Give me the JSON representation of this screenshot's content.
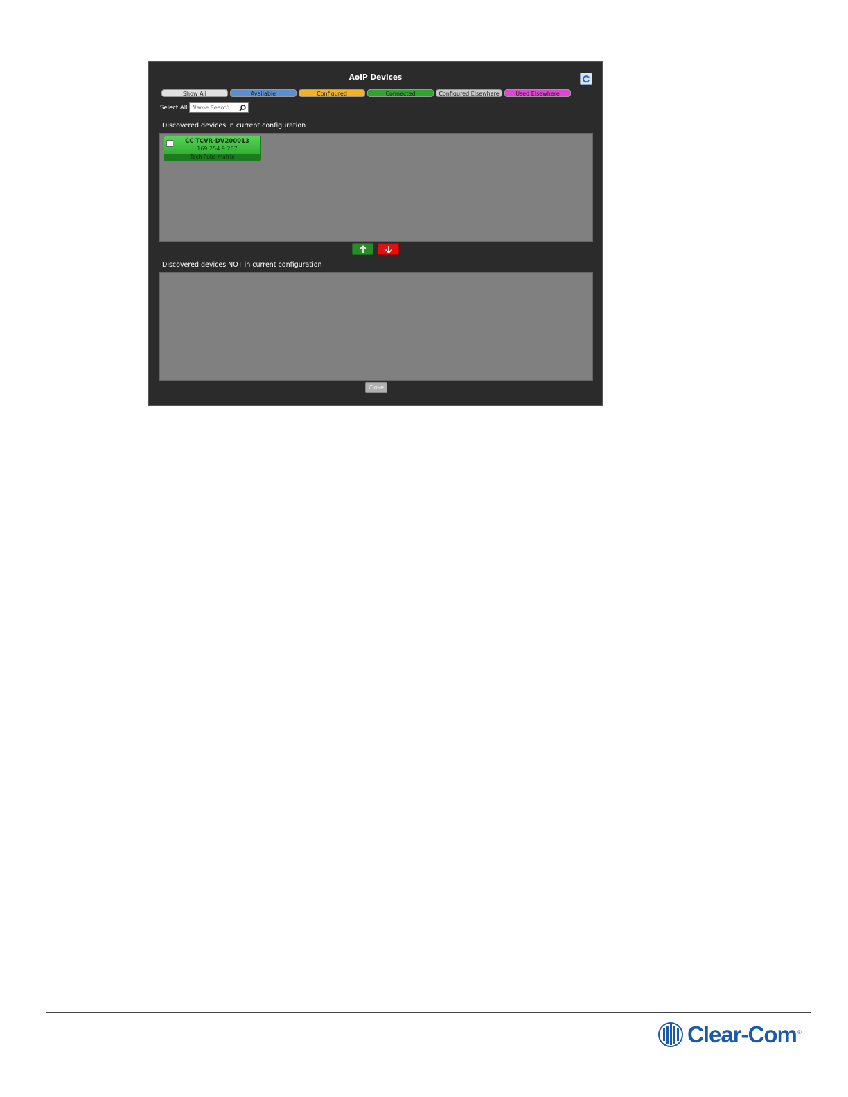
{
  "dialog": {
    "title": "AoIP Devices",
    "refresh_icon": "refresh-icon"
  },
  "filters": [
    {
      "label": "Show All",
      "color": "#e0e0e0"
    },
    {
      "label": "Available",
      "color": "#5b8fd0"
    },
    {
      "label": "Configured",
      "color": "#f2b127"
    },
    {
      "label": "Connected",
      "color": "#2fa52f"
    },
    {
      "label": "Configured Elsewhere",
      "color": "#c9c9c9"
    },
    {
      "label": "Used Elsewhere",
      "color": "#e046d6"
    }
  ],
  "select_all_label": "Select All",
  "search": {
    "placeholder": "Name Search",
    "icon": "search-icon"
  },
  "current_section": {
    "label": "Discovered devices in current configuration",
    "devices": [
      {
        "name": "CC-TCVR-DV200013",
        "ip": "169.254.9.207",
        "matrix": "Tech Pubs matrix",
        "status_color": "#2fa52f"
      }
    ]
  },
  "move_buttons": {
    "up": {
      "icon": "arrow-up-icon",
      "color": "#2b8a2b"
    },
    "down": {
      "icon": "arrow-down-icon",
      "color": "#e01010"
    }
  },
  "other_section": {
    "label": "Discovered devices NOT in current configuration",
    "devices": []
  },
  "close_label": "Close",
  "footer": {
    "brand": "Clear-Com",
    "registered_mark": "®",
    "brand_color": "#1b5aa8"
  }
}
